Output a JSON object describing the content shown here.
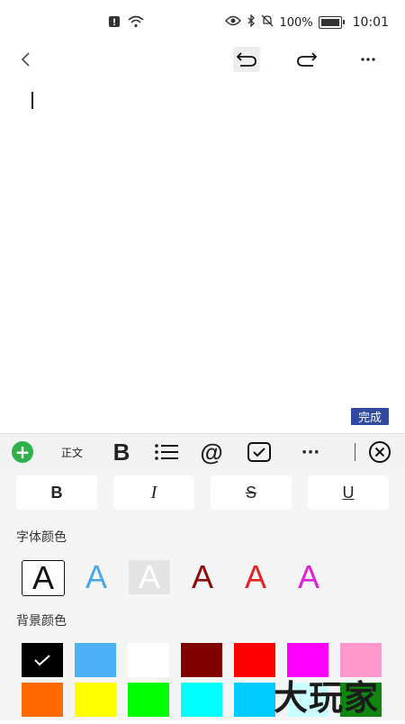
{
  "statusbar": {
    "battery_percent": "100%",
    "time": "10:01",
    "icons": [
      "alert-icon",
      "wifi-icon",
      "eye-icon",
      "bluetooth-icon",
      "mute-bell-icon",
      "battery-icon"
    ]
  },
  "toolbar": {
    "back_icon": "chevron-left-icon",
    "undo_icon": "undo-icon",
    "redo_icon": "redo-icon",
    "more_icon": "more-horizontal-icon"
  },
  "editor": {
    "content": ""
  },
  "done_label": "完成",
  "format_bar": {
    "style_label": "正文",
    "bold_label": "B",
    "at_label": "@",
    "more_label": "···",
    "icons": [
      "plus-circle-icon",
      "list-icon",
      "checkbox-icon",
      "close-circle-icon"
    ]
  },
  "text_style": {
    "bold": "B",
    "italic": "I",
    "strike": "S",
    "underline": "U"
  },
  "font_color_label": "字体颜色",
  "font_colors": [
    {
      "letter": "A",
      "color": "#111111",
      "selected": true
    },
    {
      "letter": "A",
      "color": "#4aa8e8"
    },
    {
      "letter": "A",
      "color": "#ffffff"
    },
    {
      "letter": "A",
      "color": "#8b0a0a"
    },
    {
      "letter": "A",
      "color": "#e32424"
    },
    {
      "letter": "A",
      "color": "#e021d8"
    }
  ],
  "bg_color_label": "背景颜色",
  "bg_colors": [
    "#000000",
    "#4db2f5",
    "#ffffff",
    "#800000",
    "#ff0000",
    "#ff00ff",
    "#ff99cc",
    "#ff6a00",
    "#ffff00",
    "#00ff00",
    "#00ffff",
    "#00ccff",
    "#ccffff",
    "#108510"
  ],
  "watermark": "大玩家"
}
